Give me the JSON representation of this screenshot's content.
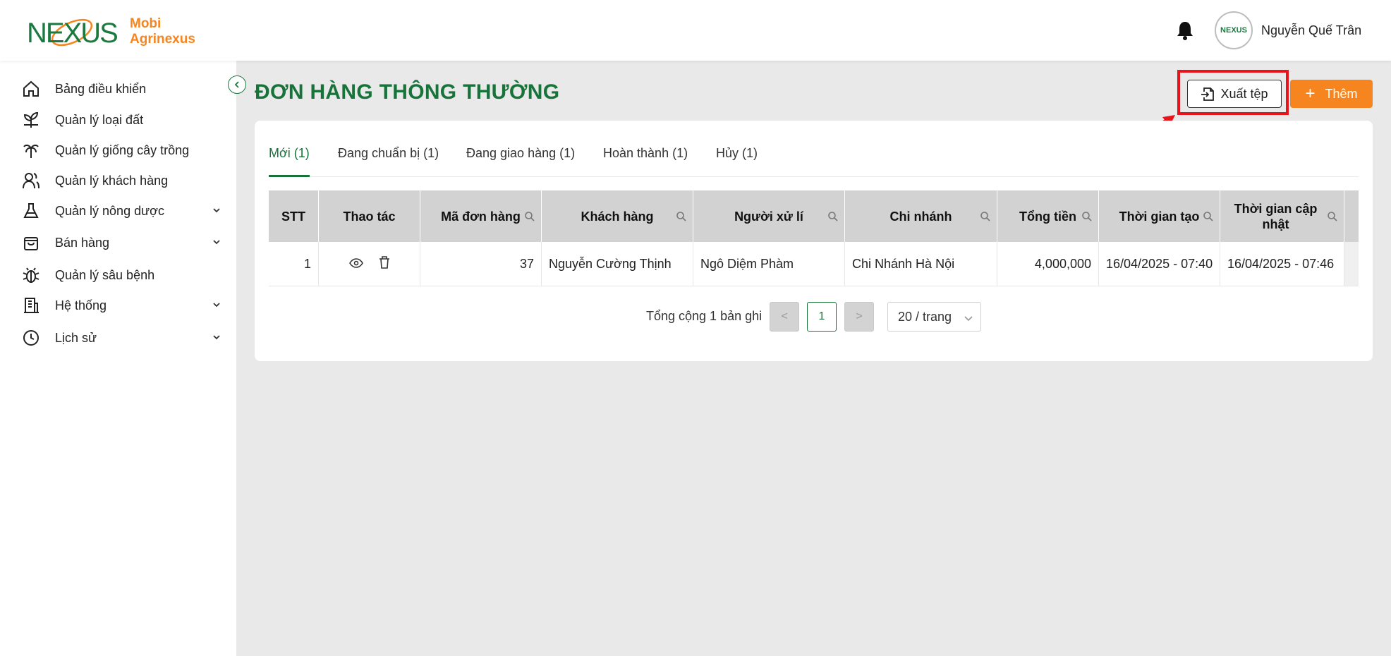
{
  "brand": {
    "logo_word": "NEXUS",
    "name_line1": "Mobi",
    "name_line2": "Agrinexus",
    "logo_green": "#1a7a3f",
    "logo_orange": "#f7851f"
  },
  "header": {
    "user_name": "Nguyễn Quế Trân",
    "avatar_text": "NEXUS"
  },
  "sidebar": {
    "items": [
      {
        "label": "Bảng điều khiển",
        "icon": "home-icon",
        "expandable": false
      },
      {
        "label": "Quản lý loại đất",
        "icon": "sprout-icon",
        "expandable": false
      },
      {
        "label": "Quản lý giống cây trồng",
        "icon": "palm-icon",
        "expandable": false
      },
      {
        "label": "Quản lý khách hàng",
        "icon": "users-icon",
        "expandable": false
      },
      {
        "label": "Quản lý nông dược",
        "icon": "flask-icon",
        "expandable": true
      },
      {
        "label": "Bán hàng",
        "icon": "bag-icon",
        "expandable": true
      },
      {
        "label": "Quản lý sâu bệnh",
        "icon": "bug-icon",
        "expandable": false
      },
      {
        "label": "Hệ thống",
        "icon": "building-icon",
        "expandable": true
      },
      {
        "label": "Lịch sử",
        "icon": "clock-icon",
        "expandable": true
      }
    ]
  },
  "page": {
    "title": "ĐƠN HÀNG THÔNG THƯỜNG",
    "export_label": "Xuất tệp",
    "add_label": "Thêm",
    "accent_color": "#17733a",
    "add_color": "#f7851f",
    "highlight_color": "#e8141b"
  },
  "tabs": [
    {
      "label": "Mới (1)",
      "active": true
    },
    {
      "label": "Đang chuẩn bị (1)",
      "active": false
    },
    {
      "label": "Đang giao hàng (1)",
      "active": false
    },
    {
      "label": "Hoàn thành (1)",
      "active": false
    },
    {
      "label": "Hủy (1)",
      "active": false
    }
  ],
  "table": {
    "columns": [
      "STT",
      "Thao tác",
      "Mã đơn hàng",
      "Khách hàng",
      "Người xử lí",
      "Chi nhánh",
      "Tổng tiền",
      "Thời gian tạo",
      "Thời gian cập nhật"
    ],
    "rows": [
      {
        "stt": "1",
        "ma_don_hang": "37",
        "khach_hang": "Nguyễn Cường Thịnh",
        "nguoi_xu_li": "Ngô Diệm Phàm",
        "chi_nhanh": "Chi Nhánh Hà Nội",
        "tong_tien": "4,000,000",
        "thoi_gian_tao": "16/04/2025 - 07:40",
        "thoi_gian_cap_nhat": "16/04/2025 - 07:46"
      }
    ]
  },
  "pagination": {
    "total_text": "Tổng cộng 1 bản ghi",
    "current_page": "1",
    "prev": "<",
    "next": ">",
    "page_size": "20 / trang"
  }
}
